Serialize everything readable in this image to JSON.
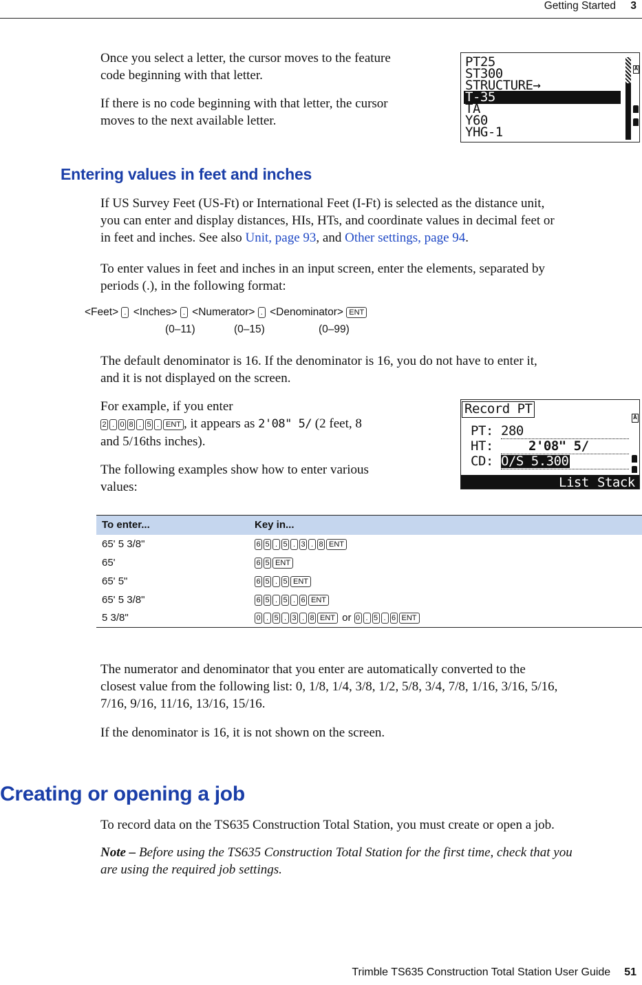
{
  "header": {
    "section": "Getting Started",
    "chapter": "3"
  },
  "intro": {
    "p1": "Once you select a letter, the cursor moves to the feature code beginning with that letter.",
    "p1_line1": "Once you select a letter, the cursor moves to the feature",
    "p1_line2": "code beginning with that letter.",
    "p2_line1": "If there is no code beginning with that letter, the cursor",
    "p2_line2": "moves to the next available letter."
  },
  "screen1": {
    "lines": [
      "PT25",
      "ST300",
      "STRUCTURE→",
      "T-35",
      "TA",
      "Y60",
      "YHG-1"
    ],
    "selected_index": 3,
    "mode_indicator": "A"
  },
  "section_feet": {
    "heading": "Entering values in feet and inches",
    "para1_line1": "If US Survey Feet (US-Ft) or International Feet (I-Ft) is selected as the distance unit,",
    "para1_line2": "you can enter and display distances, HIs, HTs, and coordinate values in decimal feet or",
    "para1_line3_pre": "in feet and inches. See also ",
    "link_unit": "Unit, page 93",
    "para1_line3_mid": ", and ",
    "link_other": "Other settings, page 94",
    "para1_line3_post": ".",
    "para2_line1": "To enter values in feet and inches in an input screen, enter the elements, separated by",
    "para2_line2": "periods (.), in the following format:",
    "format": {
      "feet": "<Feet>",
      "inches": "<Inches>",
      "numerator": "<Numerator>",
      "denominator": "<Denominator>",
      "dot_key": ".",
      "ent_key": "ENT",
      "range_inches": "(0–11)",
      "range_numerator": "(0–15)",
      "range_denominator": "(0–99)"
    },
    "para3_line1": "The default denominator is 16. If the denominator is 16, you do not have to enter it,",
    "para3_line2": "and it is not displayed on the screen.",
    "example_line1": "For example, if you enter",
    "example_keys": [
      "2",
      ".",
      "0",
      "8",
      ".",
      "5",
      ".",
      "ENT"
    ],
    "example_mid": ", it appears as ",
    "example_display": "2'08\"  5/",
    "example_post": " (2 feet, 8",
    "example_line3": "and 5/16ths inches).",
    "following_line1": "The following examples show how to enter various",
    "following_line2": "values:"
  },
  "screen2": {
    "title": "Record PT",
    "mode_indicator": "A",
    "pt_label": "PT:",
    "pt_value": "280",
    "ht_label": "HT:",
    "ht_value": "2'08\" 5/",
    "cd_label": "CD:",
    "cd_value": "O/S 5.300",
    "softkeys": [
      "List",
      "Stack"
    ]
  },
  "table": {
    "headers": [
      "To enter...",
      "Key in..."
    ],
    "rows": [
      {
        "value": "65' 5 3/8\"",
        "keys": [
          "6",
          "5",
          ".",
          "5",
          ".",
          "3",
          ".",
          "8",
          "ENT"
        ]
      },
      {
        "value": "65'",
        "keys": [
          "6",
          "5",
          "ENT"
        ]
      },
      {
        "value": "65' 5\"",
        "keys": [
          "6",
          "5",
          ".",
          "5",
          "ENT"
        ]
      },
      {
        "value": "65' 5 3/8\"",
        "keys": [
          "6",
          "5",
          ".",
          "5",
          ".",
          "6",
          "ENT"
        ]
      },
      {
        "value": "5 3/8\"",
        "keys": [
          "0",
          ".",
          "5",
          ".",
          "3",
          ".",
          "8",
          "ENT"
        ],
        "or_label": "or",
        "alt_keys": [
          "0",
          ".",
          "5",
          ".",
          "6",
          "ENT"
        ]
      }
    ]
  },
  "after_table": {
    "p1_line1": "The numerator and denominator that you enter are automatically converted to the",
    "p1_line2": "closest value from the following list: 0, 1/8, 1/4, 3/8, 1/2, 5/8, 3/4, 7/8, 1/16, 3/16, 5/16,",
    "p1_line3": "7/16, 9/16, 11/16, 13/16, 15/16.",
    "p2": "If the denominator is 16, it is not shown on the screen."
  },
  "section_job": {
    "heading": "Creating or opening a job",
    "p1": "To record data on the TS635 Construction Total Station, you must create or open a job.",
    "note_label": "Note –",
    "note_line1": " Before using the TS635 Construction Total Station for the first time, check that you",
    "note_line2": "are using the required job settings."
  },
  "footer": {
    "title": "Trimble TS635 Construction Total Station User Guide",
    "page": "51"
  }
}
